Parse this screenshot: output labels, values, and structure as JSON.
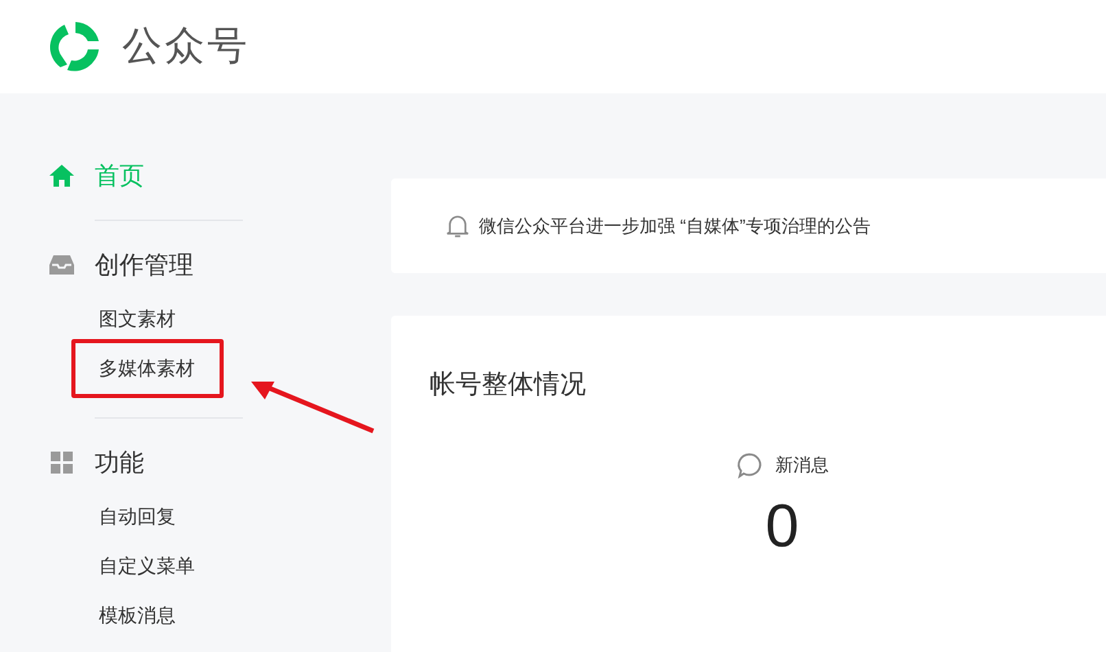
{
  "header": {
    "title": "公众号"
  },
  "sidebar": {
    "items": [
      {
        "label": "首页",
        "selected": true
      },
      {
        "label": "创作管理",
        "selected": false,
        "children": [
          {
            "label": "图文素材",
            "highlighted": false
          },
          {
            "label": "多媒体素材",
            "highlighted": true
          }
        ]
      },
      {
        "label": "功能",
        "selected": false,
        "children": [
          {
            "label": "自动回复",
            "highlighted": false
          },
          {
            "label": "自定义菜单",
            "highlighted": false
          },
          {
            "label": "模板消息",
            "highlighted": false
          }
        ]
      }
    ]
  },
  "notice": {
    "text": "微信公众平台进一步加强 “自媒体”专项治理的公告"
  },
  "overview": {
    "title": "帐号整体情况",
    "stats": [
      {
        "label": "新消息",
        "value": "0"
      }
    ]
  }
}
